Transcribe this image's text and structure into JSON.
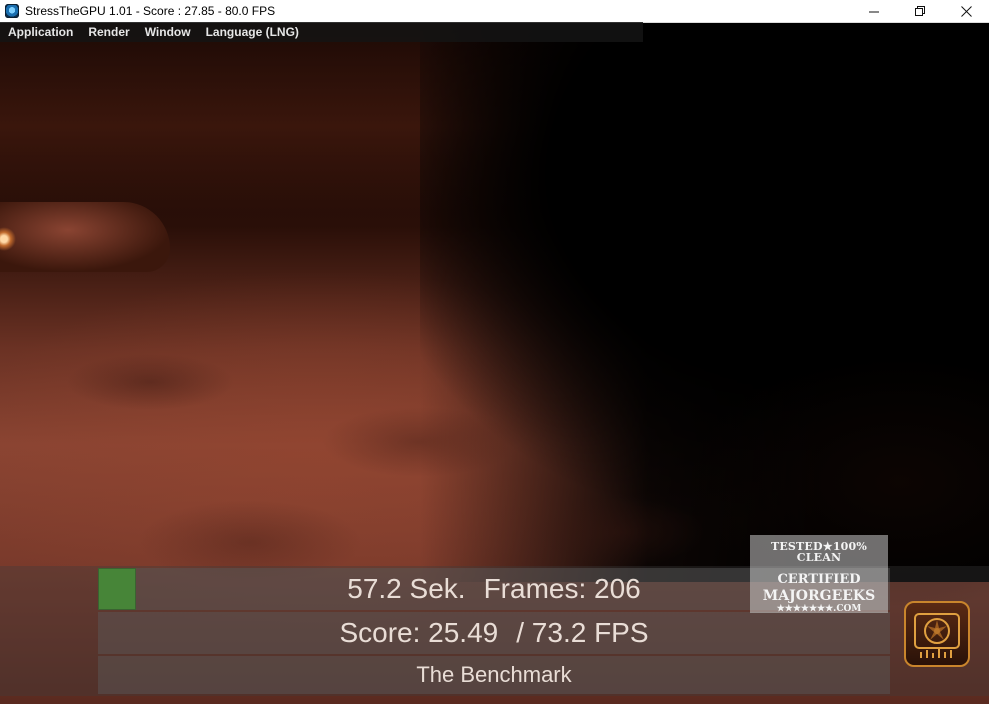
{
  "window": {
    "title": "StressTheGPU 1.01 - Score : 27.85 - 80.0 FPS",
    "minimize_glyph": "—",
    "maximize_glyph": "❐",
    "close_glyph": "✕"
  },
  "menu": {
    "items": [
      {
        "label": "Application"
      },
      {
        "label": "Render"
      },
      {
        "label": "Window"
      },
      {
        "label": "Language (LNG)"
      }
    ]
  },
  "hud": {
    "time": "57.2 Sek.",
    "frames": "Frames: 206",
    "score": "Score: 25.49",
    "fps": "/ 73.2 FPS",
    "mode": "The Benchmark",
    "status_color": "#37a81c"
  },
  "watermark": {
    "line1": "TESTED★100% CLEAN",
    "line2": "CERTIFIED",
    "line3": "MAJORGEEKS",
    "line4": "★★★★★★★.COM"
  },
  "icons": {
    "app": "gpu-app-icon",
    "logo": "gpu-fan-logo-icon"
  }
}
